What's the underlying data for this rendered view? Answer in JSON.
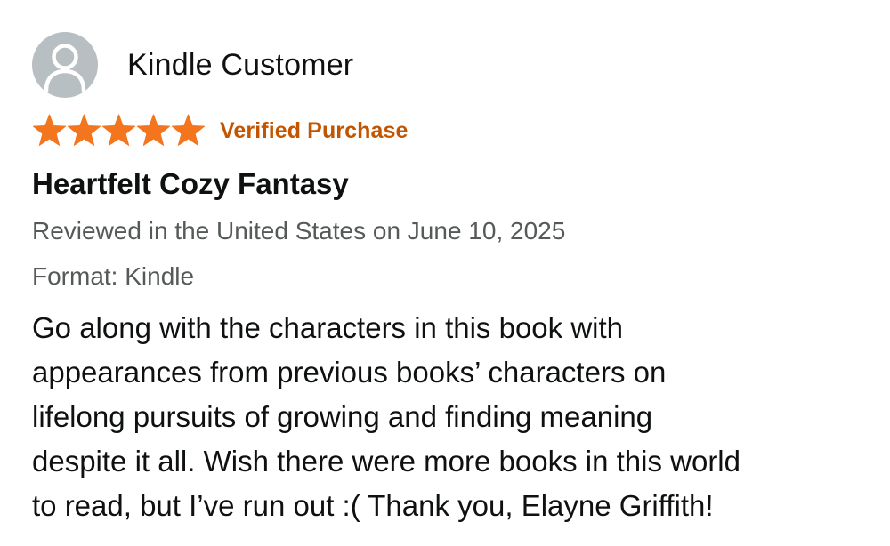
{
  "reviewer": {
    "name": "Kindle Customer",
    "avatar_icon": "user-silhouette-icon"
  },
  "rating": {
    "stars": 5,
    "out_of": 5,
    "star_color": "#f3761f",
    "verified_label": "Verified Purchase",
    "verified_color": "#c45500"
  },
  "review": {
    "title": "Heartfelt Cozy Fantasy",
    "reviewed_line": "Reviewed in the United States on June 10, 2025",
    "format_line": "Format: Kindle",
    "body_lines": [
      "Go along with the characters in this book with",
      "appearances from previous books’ characters on",
      "lifelong pursuits of growing and finding meaning",
      "despite it all. Wish there were more books in this world",
      "to read, but I’ve run out :( Thank you, Elayne Griffith!"
    ]
  }
}
